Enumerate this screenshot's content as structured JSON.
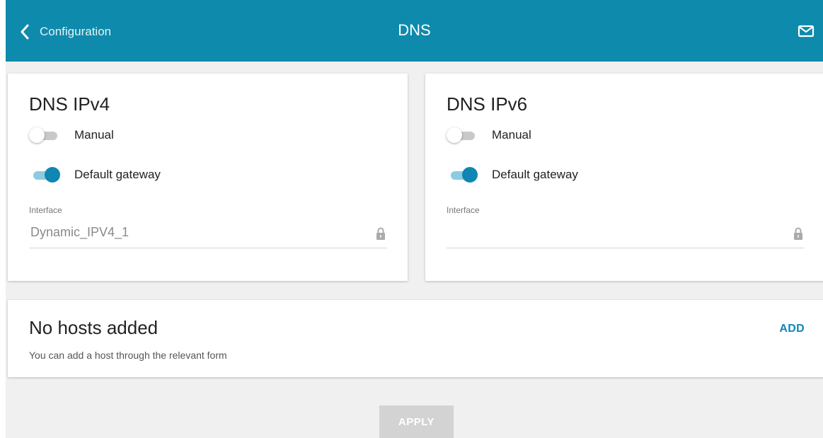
{
  "header": {
    "back_label": "Configuration",
    "title": "DNS"
  },
  "dns_ipv4": {
    "title": "DNS IPv4",
    "manual_label": "Manual",
    "manual_enabled": false,
    "default_gateway_label": "Default gateway",
    "default_gateway_enabled": true,
    "interface_label": "Interface",
    "interface_value": "Dynamic_IPV4_1"
  },
  "dns_ipv6": {
    "title": "DNS IPv6",
    "manual_label": "Manual",
    "manual_enabled": false,
    "default_gateway_label": "Default gateway",
    "default_gateway_enabled": true,
    "interface_label": "Interface",
    "interface_value": ""
  },
  "hosts": {
    "title": "No hosts added",
    "subtitle": "You can add a host through the relevant form",
    "add_label": "ADD"
  },
  "apply_label": "APPLY",
  "icons": {
    "back": "chevron-left-icon",
    "mail": "envelope-icon",
    "lock": "lock-icon"
  },
  "colors": {
    "header_bg": "#0e8aac",
    "accent": "#0f86b4",
    "toggle_track_on": "#8ccbe0",
    "apply_disabled": "#d3d3d3"
  }
}
